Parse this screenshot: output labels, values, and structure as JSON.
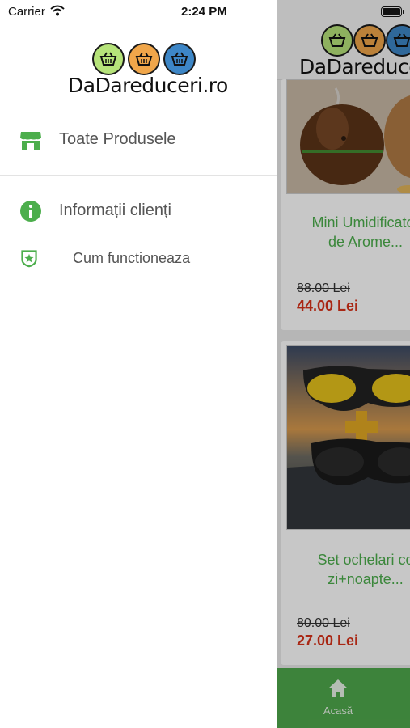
{
  "status_bar": {
    "carrier": "Carrier",
    "time": "2:24 PM"
  },
  "brand": {
    "logo_text": "DaDareduceri.ro",
    "circle_colors": [
      "#b6e37a",
      "#f0a64a",
      "#3d86c6"
    ]
  },
  "menu": {
    "items": [
      {
        "label": "Toate Produsele",
        "icon": "store-icon"
      },
      {
        "label": "Informații clienți",
        "icon": "info-icon"
      },
      {
        "label": "Cum functioneaza",
        "icon": "badge-star-icon"
      }
    ]
  },
  "products": [
    {
      "title_line1": "Mini Umidificator",
      "title_line2": "de Arome...",
      "old_price": "88.00 Lei",
      "new_price": "44.00 Lei"
    },
    {
      "title_line1": "Set ochelari co",
      "title_line2": "zi+noapte...",
      "old_price": "80.00 Lei",
      "new_price": "27.00 Lei"
    }
  ],
  "tabbar": {
    "home_label": "Acasă",
    "icon": "home-icon"
  },
  "colors": {
    "accent_green": "#4fa84c",
    "price_red": "#d9331a",
    "title_green": "#4cae4c"
  }
}
